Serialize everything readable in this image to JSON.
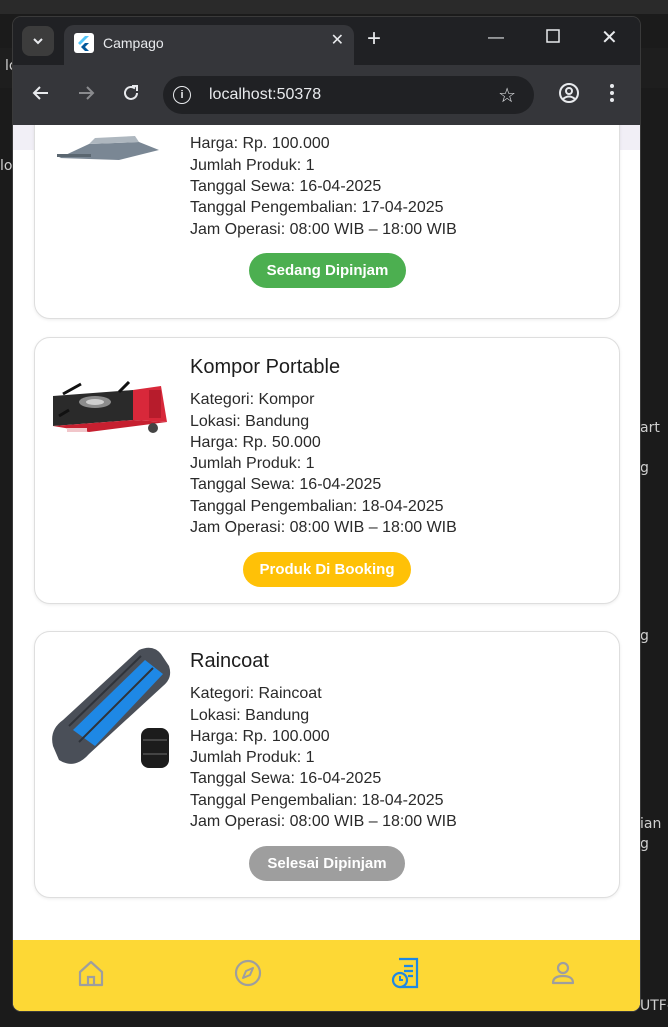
{
  "browser": {
    "tab_title": "Campago",
    "url": "localhost:50378"
  },
  "background_fragments": {
    "f1": "lo",
    "f2": "lo",
    "f3": "art",
    "f4": "g",
    "f5": "g",
    "f6": "ian",
    "f7": "g",
    "f8": "UTF-"
  },
  "cards": [
    {
      "name": "",
      "lines": {
        "harga": "Harga: Rp. 100.000",
        "jumlah": "Jumlah Produk: 1",
        "sewa": "Tanggal Sewa: 16-04-2025",
        "kembali": "Tanggal Pengembalian: 17-04-2025",
        "jam": "Jam Operasi: 08:00 WIB – 18:00 WIB"
      },
      "status": "Sedang Dipinjam",
      "status_color": "#4caf50"
    },
    {
      "name": "Kompor Portable",
      "lines": {
        "kategori": "Kategori: Kompor",
        "lokasi": "Lokasi: Bandung",
        "harga": "Harga: Rp. 50.000",
        "jumlah": "Jumlah Produk: 1",
        "sewa": "Tanggal Sewa: 16-04-2025",
        "kembali": "Tanggal Pengembalian: 18-04-2025",
        "jam": "Jam Operasi: 08:00 WIB – 18:00 WIB"
      },
      "status": "Produk Di Booking",
      "status_color": "#ffc107"
    },
    {
      "name": "Raincoat",
      "lines": {
        "kategori": "Kategori: Raincoat",
        "lokasi": "Lokasi: Bandung",
        "harga": "Harga: Rp. 100.000",
        "jumlah": "Jumlah Produk: 1",
        "sewa": "Tanggal Sewa: 16-04-2025",
        "kembali": "Tanggal Pengembalian: 18-04-2025",
        "jam": "Jam Operasi: 08:00 WIB – 18:00 WIB"
      },
      "status": "Selesai Dipinjam",
      "status_color": "#9e9e9e"
    }
  ],
  "bottom_nav": {
    "items": [
      "home-icon",
      "compass-icon",
      "history-icon",
      "profile-icon"
    ],
    "active": "history-icon",
    "bar_color": "#fdd835",
    "active_color": "#1e88e5",
    "inactive_color": "#9e9e9e"
  }
}
